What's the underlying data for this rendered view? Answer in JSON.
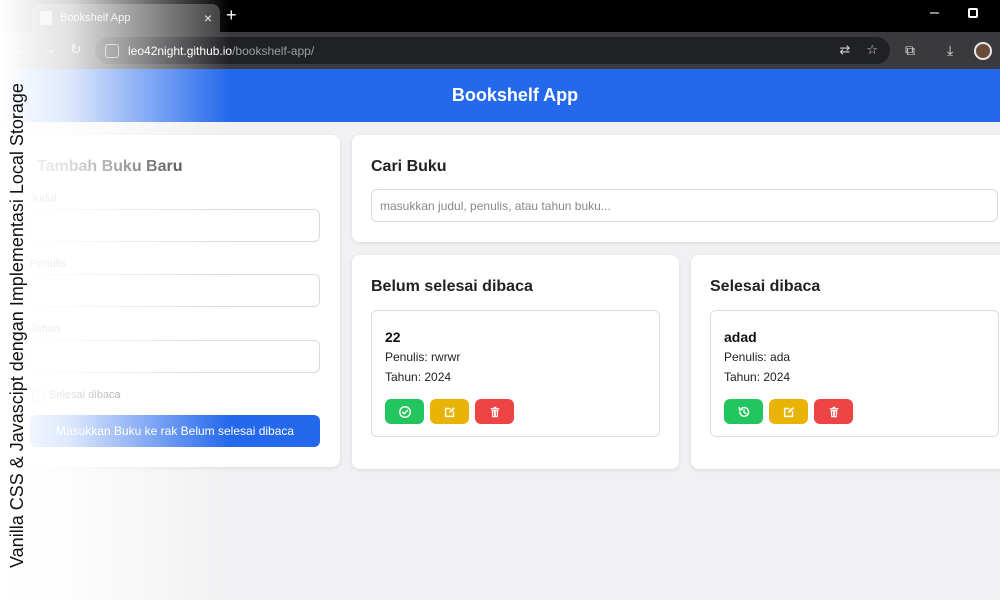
{
  "browser": {
    "tab_title": "Bookshelf App",
    "tab_close": "×",
    "new_tab": "+",
    "url_host": "leo42night.github.io",
    "url_path": "/bookshelf-app/",
    "back": "←",
    "forward": "→",
    "reload": "↻",
    "minimize": "–"
  },
  "app": {
    "title": "Bookshelf App"
  },
  "add_form": {
    "heading": "Tambah Buku Baru",
    "title_label": "Judul",
    "author_label": "Penulis",
    "year_label": "Tahun",
    "checkbox_label": "Selesai dibaca",
    "submit_label": "Masukkan Buku ke rak Belum selesai dibaca"
  },
  "search": {
    "heading": "Cari Buku",
    "placeholder": "masukkan judul, penulis, atau tahun buku..."
  },
  "shelves": {
    "unread": {
      "heading": "Belum selesai dibaca",
      "books": [
        {
          "title": "22",
          "author": "Penulis: rwrwr",
          "year": "Tahun: 2024"
        }
      ]
    },
    "read": {
      "heading": "Selesai dibaca",
      "books": [
        {
          "title": "adad",
          "author": "Penulis: ada",
          "year": "Tahun: 2024"
        }
      ]
    }
  },
  "overlay": {
    "caption": "Vanilla CSS & Javascipt dengan Implementasi Local Storage"
  },
  "colors": {
    "primary": "#2468ec",
    "green": "#22c55e",
    "yellow": "#eab308",
    "red": "#ef4444",
    "background": "#f1f1f3"
  },
  "icons": {
    "complete": "check-circle-icon",
    "undo": "history-icon",
    "edit": "edit-icon",
    "delete": "trash-icon"
  }
}
